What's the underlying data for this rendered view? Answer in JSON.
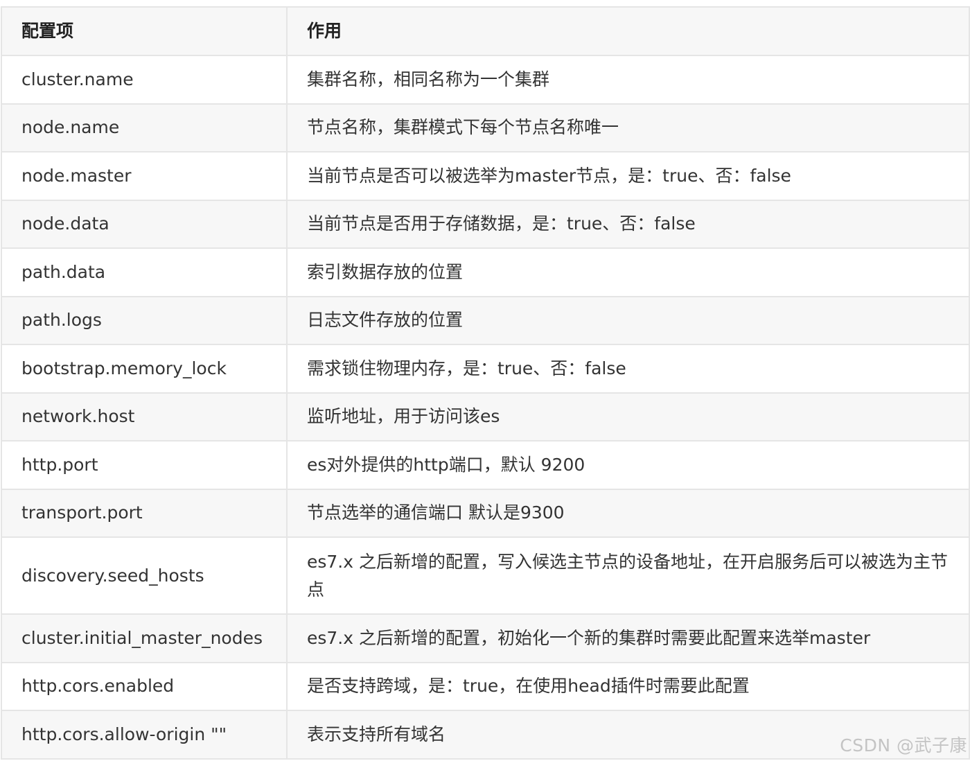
{
  "table": {
    "headers": [
      "配置项",
      "作用"
    ],
    "rows": [
      {
        "key": "cluster.name",
        "desc": "集群名称，相同名称为一个集群"
      },
      {
        "key": "node.name",
        "desc": "节点名称，集群模式下每个节点名称唯一"
      },
      {
        "key": "node.master",
        "desc": "当前节点是否可以被选举为master节点，是：true、否：false"
      },
      {
        "key": "node.data",
        "desc": "当前节点是否用于存储数据，是：true、否：false"
      },
      {
        "key": "path.data",
        "desc": "索引数据存放的位置"
      },
      {
        "key": "path.logs",
        "desc": "日志文件存放的位置"
      },
      {
        "key": "bootstrap.memory_lock",
        "desc": "需求锁住物理内存，是：true、否：false"
      },
      {
        "key": "network.host",
        "desc": "监听地址，用于访问该es"
      },
      {
        "key": "http.port",
        "desc": "es对外提供的http端口，默认 9200"
      },
      {
        "key": "transport.port",
        "desc": "节点选举的通信端口 默认是9300"
      },
      {
        "key": "discovery.seed_hosts",
        "desc": "es7.x 之后新增的配置，写入候选主节点的设备地址，在开启服务后可以被选为主节点"
      },
      {
        "key": "cluster.initial_master_nodes",
        "desc": "es7.x 之后新增的配置，初始化一个新的集群时需要此配置来选举master"
      },
      {
        "key": "http.cors.enabled",
        "desc": "是否支持跨域，是：true，在使用head插件时需要此配置"
      },
      {
        "key": "http.cors.allow-origin \"\"",
        "desc": "表示支持所有域名"
      }
    ]
  },
  "watermark": "CSDN @武子康"
}
